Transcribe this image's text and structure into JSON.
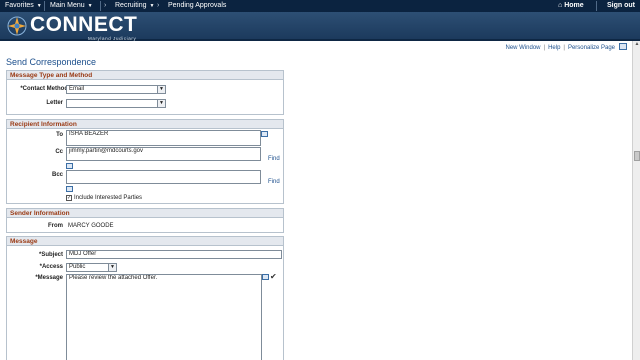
{
  "nav": {
    "favorites": "Favorites",
    "main_menu": "Main Menu",
    "recruiting": "Recruiting",
    "pending_approvals": "Pending Approvals",
    "home": "Home",
    "sign_out": "Sign out"
  },
  "banner": {
    "logo": "CONNECT",
    "subtitle": "Maryland Judiciary"
  },
  "page_links": {
    "new_window": "New Window",
    "help": "Help",
    "personalize_page": "Personalize Page"
  },
  "page_title": "Send Correspondence",
  "message_type": {
    "header": "Message Type and Method",
    "contact_method_label": "*Contact Method",
    "contact_method_value": "Email",
    "letter_label": "Letter",
    "letter_value": ""
  },
  "recipient": {
    "header": "Recipient Information",
    "to_label": "To",
    "to_value": "ISHA BEAZER",
    "cc_label": "Cc",
    "cc_value": "jimmy.partin@mdcourts.gov",
    "bcc_label": "Bcc",
    "bcc_value": "",
    "find_label": "Find",
    "include_interested": "Include Interested Parties",
    "include_checked": true
  },
  "sender": {
    "header": "Sender Information",
    "from_label": "From",
    "from_value": "MARCY GOODE"
  },
  "message": {
    "header": "Message",
    "subject_label": "*Subject",
    "subject_value": "MDJ Offer",
    "access_label": "*Access",
    "access_value": "Public",
    "message_label": "*Message",
    "message_value": "Please review the attached Offer."
  },
  "colors": {
    "nav_bg": "#0b2340",
    "banner_bg": "#1f3f63",
    "section_header_text": "#9a3a14",
    "link": "#1c4f8c"
  }
}
